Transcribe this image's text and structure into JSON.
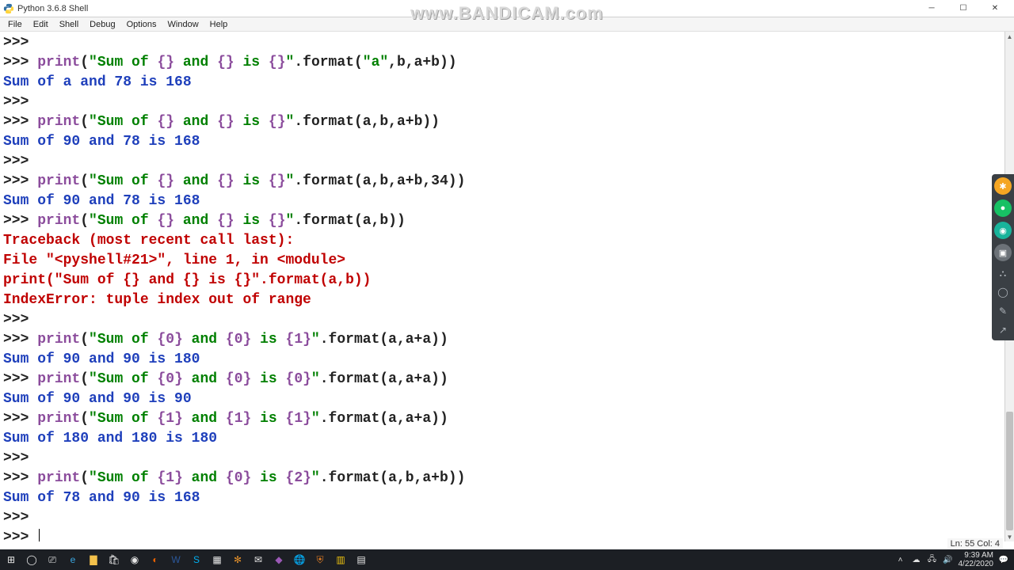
{
  "titlebar": {
    "title": "Python 3.6.8 Shell"
  },
  "menubar": {
    "items": [
      "File",
      "Edit",
      "Shell",
      "Debug",
      "Options",
      "Window",
      "Help"
    ]
  },
  "watermark": "www.BANDICAM.com",
  "shell": {
    "lines": [
      {
        "type": "prompt",
        "tokens": []
      },
      {
        "type": "prompt",
        "tokens": [
          {
            "c": "kw",
            "t": "print"
          },
          {
            "c": "plain",
            "t": "("
          },
          {
            "c": "str",
            "t": "\"Sum of "
          },
          {
            "c": "kw",
            "t": "{}"
          },
          {
            "c": "str",
            "t": " and "
          },
          {
            "c": "kw",
            "t": "{}"
          },
          {
            "c": "str",
            "t": " is "
          },
          {
            "c": "kw",
            "t": "{}"
          },
          {
            "c": "str",
            "t": "\""
          },
          {
            "c": "plain",
            "t": ".format("
          },
          {
            "c": "str",
            "t": "\"a\""
          },
          {
            "c": "plain",
            "t": ",b,a+b))"
          }
        ]
      },
      {
        "type": "out",
        "text": "Sum of a and 78 is 168"
      },
      {
        "type": "prompt",
        "tokens": []
      },
      {
        "type": "prompt",
        "tokens": [
          {
            "c": "kw",
            "t": "print"
          },
          {
            "c": "plain",
            "t": "("
          },
          {
            "c": "str",
            "t": "\"Sum of "
          },
          {
            "c": "kw",
            "t": "{}"
          },
          {
            "c": "str",
            "t": " and "
          },
          {
            "c": "kw",
            "t": "{}"
          },
          {
            "c": "str",
            "t": " is "
          },
          {
            "c": "kw",
            "t": "{}"
          },
          {
            "c": "str",
            "t": "\""
          },
          {
            "c": "plain",
            "t": ".format(a,b,a+b))"
          }
        ]
      },
      {
        "type": "out",
        "text": "Sum of 90 and 78 is 168"
      },
      {
        "type": "prompt",
        "tokens": []
      },
      {
        "type": "prompt",
        "tokens": [
          {
            "c": "kw",
            "t": "print"
          },
          {
            "c": "plain",
            "t": "("
          },
          {
            "c": "str",
            "t": "\"Sum of "
          },
          {
            "c": "kw",
            "t": "{}"
          },
          {
            "c": "str",
            "t": " and "
          },
          {
            "c": "kw",
            "t": "{}"
          },
          {
            "c": "str",
            "t": " is "
          },
          {
            "c": "kw",
            "t": "{}"
          },
          {
            "c": "str",
            "t": "\""
          },
          {
            "c": "plain",
            "t": ".format(a,b,a+b,34))"
          }
        ]
      },
      {
        "type": "out",
        "text": "Sum of 90 and 78 is 168"
      },
      {
        "type": "prompt",
        "tokens": [
          {
            "c": "kw",
            "t": "print"
          },
          {
            "c": "plain",
            "t": "("
          },
          {
            "c": "str",
            "t": "\"Sum of "
          },
          {
            "c": "kw",
            "t": "{}"
          },
          {
            "c": "str",
            "t": " and "
          },
          {
            "c": "kw",
            "t": "{}"
          },
          {
            "c": "str",
            "t": " is "
          },
          {
            "c": "kw",
            "t": "{}"
          },
          {
            "c": "str",
            "t": "\""
          },
          {
            "c": "plain",
            "t": ".format(a,b))"
          }
        ]
      },
      {
        "type": "err",
        "text": "Traceback (most recent call last):"
      },
      {
        "type": "err",
        "text": "  File \"<pyshell#21>\", line 1, in <module>"
      },
      {
        "type": "err",
        "text": "    print(\"Sum of {} and {} is {}\".format(a,b))"
      },
      {
        "type": "err",
        "text": "IndexError: tuple index out of range"
      },
      {
        "type": "prompt",
        "tokens": []
      },
      {
        "type": "prompt",
        "tokens": [
          {
            "c": "kw",
            "t": "print"
          },
          {
            "c": "plain",
            "t": "("
          },
          {
            "c": "str",
            "t": "\"Sum of "
          },
          {
            "c": "kw",
            "t": "{0}"
          },
          {
            "c": "str",
            "t": " and "
          },
          {
            "c": "kw",
            "t": "{0}"
          },
          {
            "c": "str",
            "t": " is "
          },
          {
            "c": "kw",
            "t": "{1}"
          },
          {
            "c": "str",
            "t": "\""
          },
          {
            "c": "plain",
            "t": ".format(a,a+a))"
          }
        ]
      },
      {
        "type": "out",
        "text": "Sum of 90 and 90 is 180"
      },
      {
        "type": "prompt",
        "tokens": [
          {
            "c": "kw",
            "t": "print"
          },
          {
            "c": "plain",
            "t": "("
          },
          {
            "c": "str",
            "t": "\"Sum of "
          },
          {
            "c": "kw",
            "t": "{0}"
          },
          {
            "c": "str",
            "t": " and "
          },
          {
            "c": "kw",
            "t": "{0}"
          },
          {
            "c": "str",
            "t": " is "
          },
          {
            "c": "kw",
            "t": "{0}"
          },
          {
            "c": "str",
            "t": "\""
          },
          {
            "c": "plain",
            "t": ".format(a,a+a))"
          }
        ]
      },
      {
        "type": "out",
        "text": "Sum of 90 and 90 is 90"
      },
      {
        "type": "prompt",
        "tokens": [
          {
            "c": "kw",
            "t": "print"
          },
          {
            "c": "plain",
            "t": "("
          },
          {
            "c": "str",
            "t": "\"Sum of "
          },
          {
            "c": "kw",
            "t": "{1}"
          },
          {
            "c": "str",
            "t": " and "
          },
          {
            "c": "kw",
            "t": "{1}"
          },
          {
            "c": "str",
            "t": " is "
          },
          {
            "c": "kw",
            "t": "{1}"
          },
          {
            "c": "str",
            "t": "\""
          },
          {
            "c": "plain",
            "t": ".format(a,a+a))"
          }
        ]
      },
      {
        "type": "out",
        "text": "Sum of 180 and 180 is 180"
      },
      {
        "type": "prompt",
        "tokens": []
      },
      {
        "type": "prompt",
        "tokens": [
          {
            "c": "kw",
            "t": "print"
          },
          {
            "c": "plain",
            "t": "("
          },
          {
            "c": "str",
            "t": "\"Sum of "
          },
          {
            "c": "kw",
            "t": "{1}"
          },
          {
            "c": "str",
            "t": " and "
          },
          {
            "c": "kw",
            "t": "{0}"
          },
          {
            "c": "str",
            "t": " is "
          },
          {
            "c": "kw",
            "t": "{2}"
          },
          {
            "c": "str",
            "t": "\""
          },
          {
            "c": "plain",
            "t": ".format(a,b,a+b))"
          }
        ]
      },
      {
        "type": "out",
        "text": "Sum of 78 and 90 is 168"
      },
      {
        "type": "prompt",
        "tokens": []
      },
      {
        "type": "prompt-cursor",
        "tokens": []
      }
    ]
  },
  "statusbar": {
    "text": "Ln: 55  Col: 4"
  },
  "taskbar": {
    "time": "9:39 AM",
    "date": "4/22/2020"
  }
}
